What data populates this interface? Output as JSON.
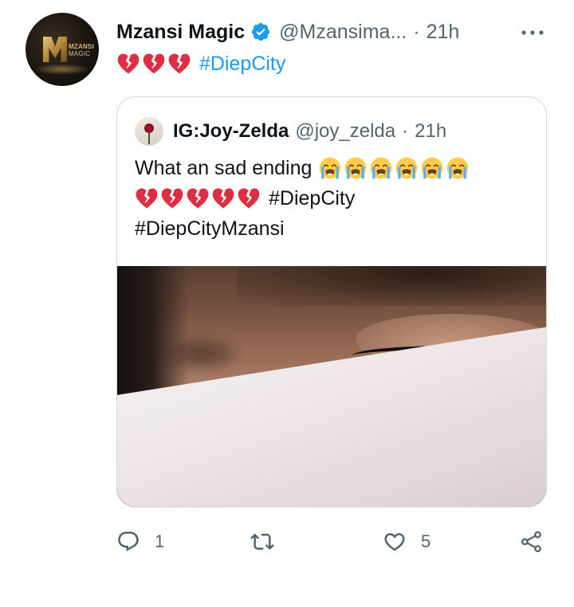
{
  "tweet": {
    "author_name": "Mzansi Magic",
    "author_handle": "@Mzansima...",
    "separator": "·",
    "time": "21h",
    "verified": true,
    "avatar_logo_line1": "MZANSI",
    "avatar_logo_line2": "MAGIC",
    "text_emojis": [
      "broken-heart",
      "broken-heart",
      "broken-heart"
    ],
    "hashtag": "#DiepCity"
  },
  "quoted_tweet": {
    "author_name": "IG:Joy-Zelda",
    "author_handle": "@joy_zelda",
    "separator": "·",
    "time": "21h",
    "text_start": "What an sad ending",
    "crying_emojis": [
      "loudly-crying-face",
      "loudly-crying-face",
      "loudly-crying-face",
      "loudly-crying-face",
      "loudly-crying-face",
      "loudly-crying-face"
    ],
    "broken_hearts": [
      "broken-heart",
      "broken-heart",
      "broken-heart",
      "broken-heart",
      "broken-heart"
    ],
    "hashtag1": "#DiepCity",
    "hashtag2": "#DiepCityMzansi",
    "media_description_icon": "photo-of-teary-eye"
  },
  "actions": {
    "reply_count": "1",
    "retweet_count": "",
    "like_count": "5"
  },
  "colors": {
    "text": "#0f1419",
    "secondary": "#536471",
    "link": "#1d9bf0",
    "border": "#cfd9de",
    "heart_red": "#dd2e44"
  }
}
